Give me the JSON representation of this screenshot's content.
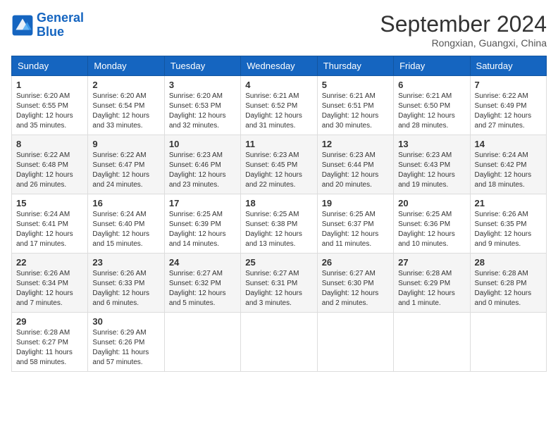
{
  "header": {
    "logo_line1": "General",
    "logo_line2": "Blue",
    "month": "September 2024",
    "location": "Rongxian, Guangxi, China"
  },
  "days_of_week": [
    "Sunday",
    "Monday",
    "Tuesday",
    "Wednesday",
    "Thursday",
    "Friday",
    "Saturday"
  ],
  "weeks": [
    [
      {
        "day": "1",
        "info": "Sunrise: 6:20 AM\nSunset: 6:55 PM\nDaylight: 12 hours\nand 35 minutes."
      },
      {
        "day": "2",
        "info": "Sunrise: 6:20 AM\nSunset: 6:54 PM\nDaylight: 12 hours\nand 33 minutes."
      },
      {
        "day": "3",
        "info": "Sunrise: 6:20 AM\nSunset: 6:53 PM\nDaylight: 12 hours\nand 32 minutes."
      },
      {
        "day": "4",
        "info": "Sunrise: 6:21 AM\nSunset: 6:52 PM\nDaylight: 12 hours\nand 31 minutes."
      },
      {
        "day": "5",
        "info": "Sunrise: 6:21 AM\nSunset: 6:51 PM\nDaylight: 12 hours\nand 30 minutes."
      },
      {
        "day": "6",
        "info": "Sunrise: 6:21 AM\nSunset: 6:50 PM\nDaylight: 12 hours\nand 28 minutes."
      },
      {
        "day": "7",
        "info": "Sunrise: 6:22 AM\nSunset: 6:49 PM\nDaylight: 12 hours\nand 27 minutes."
      }
    ],
    [
      {
        "day": "8",
        "info": "Sunrise: 6:22 AM\nSunset: 6:48 PM\nDaylight: 12 hours\nand 26 minutes."
      },
      {
        "day": "9",
        "info": "Sunrise: 6:22 AM\nSunset: 6:47 PM\nDaylight: 12 hours\nand 24 minutes."
      },
      {
        "day": "10",
        "info": "Sunrise: 6:23 AM\nSunset: 6:46 PM\nDaylight: 12 hours\nand 23 minutes."
      },
      {
        "day": "11",
        "info": "Sunrise: 6:23 AM\nSunset: 6:45 PM\nDaylight: 12 hours\nand 22 minutes."
      },
      {
        "day": "12",
        "info": "Sunrise: 6:23 AM\nSunset: 6:44 PM\nDaylight: 12 hours\nand 20 minutes."
      },
      {
        "day": "13",
        "info": "Sunrise: 6:23 AM\nSunset: 6:43 PM\nDaylight: 12 hours\nand 19 minutes."
      },
      {
        "day": "14",
        "info": "Sunrise: 6:24 AM\nSunset: 6:42 PM\nDaylight: 12 hours\nand 18 minutes."
      }
    ],
    [
      {
        "day": "15",
        "info": "Sunrise: 6:24 AM\nSunset: 6:41 PM\nDaylight: 12 hours\nand 17 minutes."
      },
      {
        "day": "16",
        "info": "Sunrise: 6:24 AM\nSunset: 6:40 PM\nDaylight: 12 hours\nand 15 minutes."
      },
      {
        "day": "17",
        "info": "Sunrise: 6:25 AM\nSunset: 6:39 PM\nDaylight: 12 hours\nand 14 minutes."
      },
      {
        "day": "18",
        "info": "Sunrise: 6:25 AM\nSunset: 6:38 PM\nDaylight: 12 hours\nand 13 minutes."
      },
      {
        "day": "19",
        "info": "Sunrise: 6:25 AM\nSunset: 6:37 PM\nDaylight: 12 hours\nand 11 minutes."
      },
      {
        "day": "20",
        "info": "Sunrise: 6:25 AM\nSunset: 6:36 PM\nDaylight: 12 hours\nand 10 minutes."
      },
      {
        "day": "21",
        "info": "Sunrise: 6:26 AM\nSunset: 6:35 PM\nDaylight: 12 hours\nand 9 minutes."
      }
    ],
    [
      {
        "day": "22",
        "info": "Sunrise: 6:26 AM\nSunset: 6:34 PM\nDaylight: 12 hours\nand 7 minutes."
      },
      {
        "day": "23",
        "info": "Sunrise: 6:26 AM\nSunset: 6:33 PM\nDaylight: 12 hours\nand 6 minutes."
      },
      {
        "day": "24",
        "info": "Sunrise: 6:27 AM\nSunset: 6:32 PM\nDaylight: 12 hours\nand 5 minutes."
      },
      {
        "day": "25",
        "info": "Sunrise: 6:27 AM\nSunset: 6:31 PM\nDaylight: 12 hours\nand 3 minutes."
      },
      {
        "day": "26",
        "info": "Sunrise: 6:27 AM\nSunset: 6:30 PM\nDaylight: 12 hours\nand 2 minutes."
      },
      {
        "day": "27",
        "info": "Sunrise: 6:28 AM\nSunset: 6:29 PM\nDaylight: 12 hours\nand 1 minute."
      },
      {
        "day": "28",
        "info": "Sunrise: 6:28 AM\nSunset: 6:28 PM\nDaylight: 12 hours\nand 0 minutes."
      }
    ],
    [
      {
        "day": "29",
        "info": "Sunrise: 6:28 AM\nSunset: 6:27 PM\nDaylight: 11 hours\nand 58 minutes."
      },
      {
        "day": "30",
        "info": "Sunrise: 6:29 AM\nSunset: 6:26 PM\nDaylight: 11 hours\nand 57 minutes."
      },
      {
        "day": "",
        "info": ""
      },
      {
        "day": "",
        "info": ""
      },
      {
        "day": "",
        "info": ""
      },
      {
        "day": "",
        "info": ""
      },
      {
        "day": "",
        "info": ""
      }
    ]
  ]
}
